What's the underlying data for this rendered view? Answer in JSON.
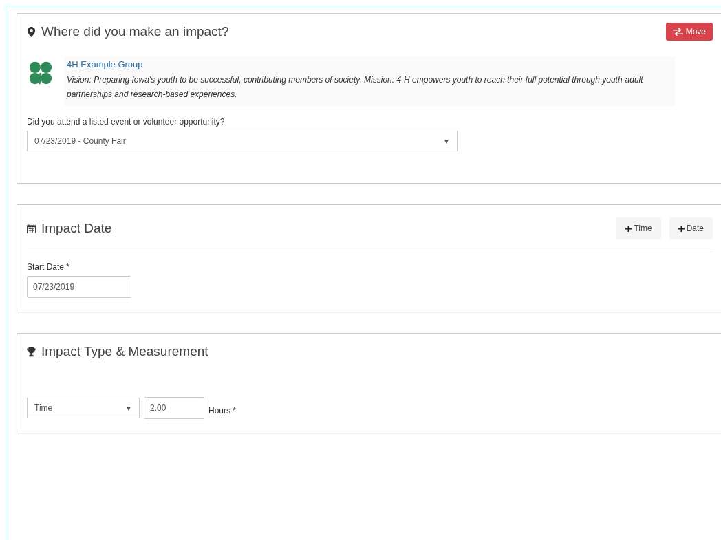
{
  "sections": [
    {
      "kind": "location",
      "title": "Where did you make an impact?",
      "move_button": "Move",
      "group": {
        "name": "4H Example Group",
        "description": "Vision: Preparing Iowa's youth to be successful, contributing members of society. Mission: 4-H empowers youth to reach their full potential through youth-adult partnerships and research-based experiences."
      },
      "event_label": "Did you attend a listed event or volunteer opportunity?",
      "event_value": "07/23/2019 - County Fair",
      "event_caret": "▼"
    },
    {
      "kind": "date",
      "title": "Impact Date",
      "buttons": [
        "Time",
        "Date"
      ],
      "start_label": "Start Date *",
      "start_value": "07/23/2019"
    },
    {
      "kind": "measure",
      "title": "Impact Type & Measurement",
      "type_value": "Time",
      "type_caret": "▼",
      "amount_value": "2.00",
      "unit_label": "Hours *"
    }
  ]
}
